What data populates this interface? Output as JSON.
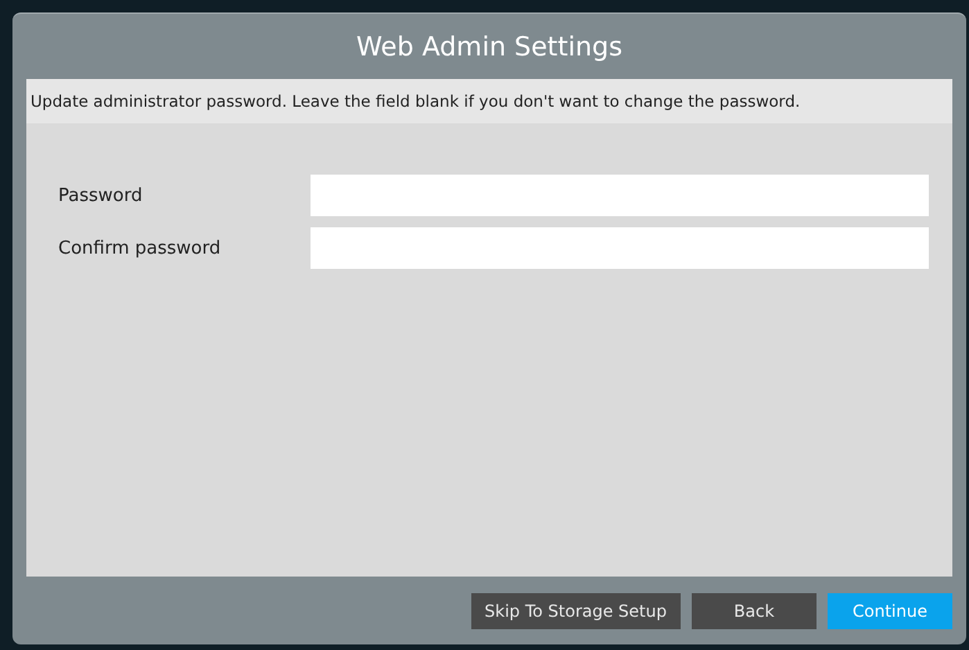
{
  "dialog": {
    "title": "Web Admin Settings",
    "description": "Update administrator password. Leave the field blank if you don't want to change the password."
  },
  "fields": [
    {
      "label": "Password"
    },
    {
      "label": "Confirm password"
    }
  ],
  "buttons": [
    {
      "label": "Skip To Storage Setup",
      "kind": "secondary"
    },
    {
      "label": "Back",
      "kind": "secondary"
    },
    {
      "label": "Continue",
      "kind": "primary"
    }
  ]
}
